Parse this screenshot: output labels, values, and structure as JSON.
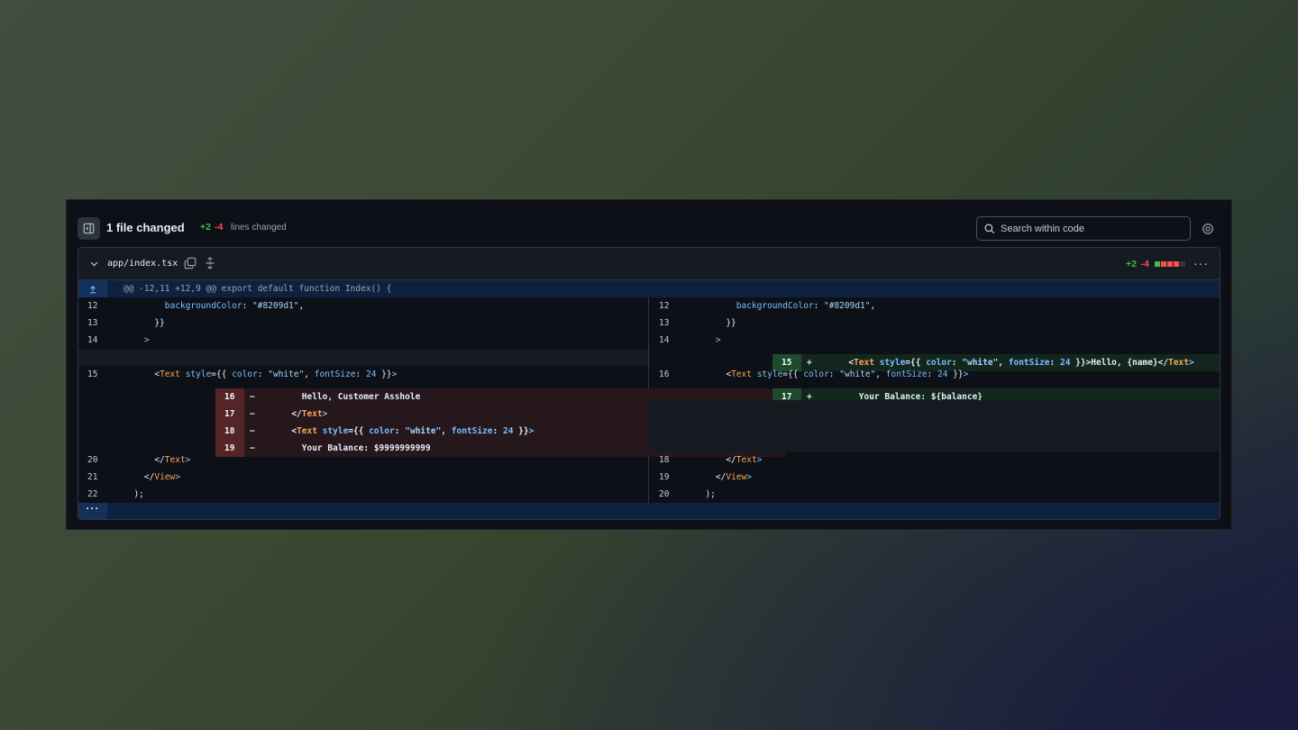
{
  "header": {
    "title": "1 file changed",
    "additions": "+2",
    "deletions": "-4",
    "lines_changed": "lines changed",
    "search_placeholder": "Search within code"
  },
  "file": {
    "name": "app/index.tsx",
    "additions": "+2",
    "deletions": "-4",
    "diffstat_colors": [
      "#3fb950",
      "#f85149",
      "#f85149",
      "#f85149",
      "#30363d"
    ]
  },
  "hunk_header": "@@ -12,11 +12,9 @@ export default function Index() {",
  "left": [
    {
      "num": "12",
      "type": "ctx",
      "mark": "",
      "code": "        backgroundColor: \"#8209d1\","
    },
    {
      "num": "13",
      "type": "ctx",
      "mark": "",
      "code": "      }}"
    },
    {
      "num": "14",
      "type": "ctx",
      "mark": "",
      "code": "    >"
    },
    {
      "num": "",
      "type": "empty",
      "mark": "",
      "code": ""
    },
    {
      "num": "15",
      "type": "ctx",
      "mark": "",
      "code": "      <Text style={{ color: \"white\", fontSize: 24 }}>"
    },
    {
      "num": "16",
      "type": "del",
      "mark": "−",
      "code": "        Hello, Customer Asshole"
    },
    {
      "num": "17",
      "type": "del",
      "mark": "−",
      "code": "      </Text>"
    },
    {
      "num": "18",
      "type": "del",
      "mark": "−",
      "code": "      <Text style={{ color: \"white\", fontSize: 24 }}>"
    },
    {
      "num": "19",
      "type": "del",
      "mark": "−",
      "code": "        Your Balance: $9999999999"
    },
    {
      "num": "20",
      "type": "ctx",
      "mark": "",
      "code": "      </Text>"
    },
    {
      "num": "21",
      "type": "ctx",
      "mark": "",
      "code": "    </View>"
    },
    {
      "num": "22",
      "type": "ctx",
      "mark": "",
      "code": "  );"
    }
  ],
  "right": [
    {
      "num": "12",
      "type": "ctx",
      "mark": "",
      "code": "        backgroundColor: \"#8209d1\","
    },
    {
      "num": "13",
      "type": "ctx",
      "mark": "",
      "code": "      }}"
    },
    {
      "num": "14",
      "type": "ctx",
      "mark": "",
      "code": "    >"
    },
    {
      "num": "15",
      "type": "add",
      "mark": "+",
      "code": "      <Text style={{ color: \"white\", fontSize: 24 }}>Hello, {name}</Text>"
    },
    {
      "num": "16",
      "type": "ctx",
      "mark": "",
      "code": "      <Text style={{ color: \"white\", fontSize: 24 }}>"
    },
    {
      "num": "17",
      "type": "add",
      "mark": "+",
      "code": "        Your Balance: ${balance}"
    },
    {
      "num": "",
      "type": "blank",
      "mark": "",
      "code": ""
    },
    {
      "num": "",
      "type": "blank",
      "mark": "",
      "code": ""
    },
    {
      "num": "",
      "type": "blank",
      "mark": "",
      "code": ""
    },
    {
      "num": "18",
      "type": "ctx",
      "mark": "",
      "code": "      </Text>"
    },
    {
      "num": "19",
      "type": "ctx",
      "mark": "",
      "code": "    </View>"
    },
    {
      "num": "20",
      "type": "ctx",
      "mark": "",
      "code": "  );"
    }
  ],
  "icons": {
    "sidebar": "sidebar-collapse-icon",
    "search": "search-icon",
    "gear": "gear-icon",
    "chevron": "chevron-down-icon",
    "copy": "copy-icon",
    "expand": "expand-icon",
    "kebab": "kebab-icon",
    "expand_up": "expand-up-icon",
    "expand_more": "ellipsis-icon"
  }
}
